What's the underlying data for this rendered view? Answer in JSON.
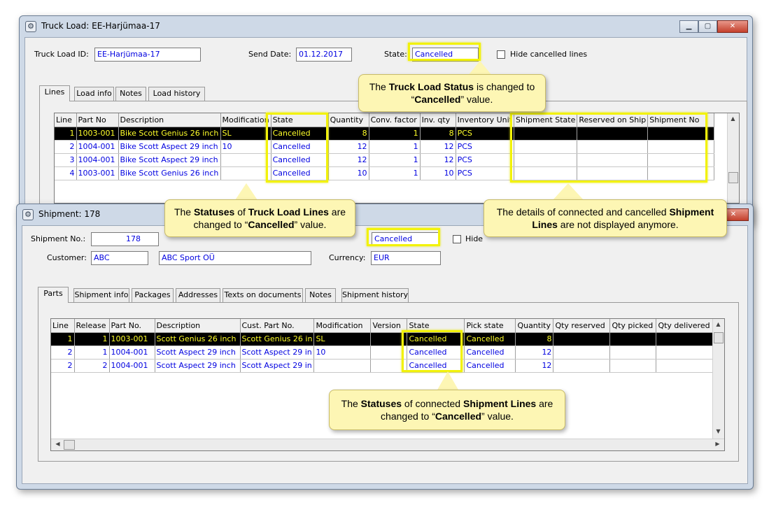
{
  "truck_window": {
    "title": "Truck Load: EE-Harjümaa-17",
    "id_label": "Truck Load ID:",
    "id_value": "EE-Harjümaa-17",
    "send_date_label": "Send Date:",
    "send_date_value": "01.12.2017",
    "state_label": "State:",
    "state_value": "Cancelled",
    "hide_label": "Hide cancelled lines",
    "tabs": [
      "Lines",
      "Load info",
      "Notes",
      "Load history"
    ],
    "columns": [
      "Line",
      "Part No",
      "Description",
      "Modification",
      "State",
      "Quantity",
      "Conv. factor",
      "Inv. qty",
      "Inventory Unit",
      "Shipment State",
      "Reserved on Ship",
      "Shipment No"
    ],
    "rows": [
      [
        "1",
        "1003-001",
        "Bike Scott Genius 26 inch",
        "SL",
        "Cancelled",
        "8",
        "1",
        "8",
        "PCS",
        "",
        "",
        ""
      ],
      [
        "2",
        "1004-001",
        "Bike Scott Aspect 29 inch",
        "10",
        "Cancelled",
        "12",
        "1",
        "12",
        "PCS",
        "",
        "",
        ""
      ],
      [
        "3",
        "1004-001",
        "Bike Scott Aspect 29 inch",
        "",
        "Cancelled",
        "12",
        "1",
        "12",
        "PCS",
        "",
        "",
        ""
      ],
      [
        "4",
        "1003-001",
        "Bike Scott Genius 26 inch",
        "",
        "Cancelled",
        "10",
        "1",
        "10",
        "PCS",
        "",
        "",
        ""
      ]
    ]
  },
  "shipment_window": {
    "title": "Shipment: 178",
    "no_label": "Shipment No.:",
    "no_value": "178",
    "state_value": "Cancelled",
    "hide_label": "Hide",
    "customer_label": "Customer:",
    "customer_code": "ABC",
    "customer_name": "ABC Sport OÜ",
    "currency_label": "Currency:",
    "currency_value": "EUR",
    "tabs": [
      "Parts",
      "Shipment info",
      "Packages",
      "Addresses",
      "Texts on documents",
      "Notes",
      "Shipment history"
    ],
    "columns": [
      "Line",
      "Release",
      "Part No.",
      "Description",
      "Cust. Part No.",
      "Modification",
      "Version",
      "State",
      "Pick state",
      "Quantity",
      "Qty reserved",
      "Qty picked",
      "Qty delivered"
    ],
    "rows": [
      [
        "1",
        "1",
        "1003-001",
        "Scott Genius 26 inch",
        "Scott Genius 26 in",
        "SL",
        "",
        "Cancelled",
        "Cancelled",
        "8",
        "",
        "",
        ""
      ],
      [
        "2",
        "1",
        "1004-001",
        "Scott Aspect 29 inch",
        "Scott Aspect 29 in",
        "10",
        "",
        "Cancelled",
        "Cancelled",
        "12",
        "",
        "",
        ""
      ],
      [
        "2",
        "2",
        "1004-001",
        "Scott Aspect 29 inch",
        "Scott Aspect 29 in",
        "",
        "",
        "Cancelled",
        "Cancelled",
        "12",
        "",
        "",
        ""
      ]
    ]
  },
  "callouts": {
    "truck_status": {
      "p1": "The ",
      "b1": "Truck Load Status",
      "p2": " is changed to “",
      "b2": "Cancelled",
      "p3": "” value."
    },
    "truck_lines": {
      "p1": "The ",
      "b1": "Statuses",
      "p2": " of ",
      "b2": "Truck Load Lines",
      "p3": " are changed to “",
      "b3": "Cancelled",
      "p4": "” value."
    },
    "shipment_details": {
      "p1": "The details of connected and cancelled ",
      "b1": "Shipment Lines",
      "p2": " are not displayed anymore."
    },
    "shipment_lines": {
      "p1": "The ",
      "b1": "Statuses",
      "p2": " of connected ",
      "b2": "Shipment Lines",
      "p3": " are changed to “",
      "b3": "Cancelled",
      "p4": "” value."
    }
  },
  "icons": {
    "window": "gear-icon",
    "minimize": "minimize-icon",
    "maximize": "maximize-icon",
    "close": "close-icon"
  },
  "colors": {
    "highlight": "#f2f20a",
    "callout_bg": "#fdf6b4",
    "selected_row_text": "#ffff2a",
    "value_text": "#0000e0"
  }
}
